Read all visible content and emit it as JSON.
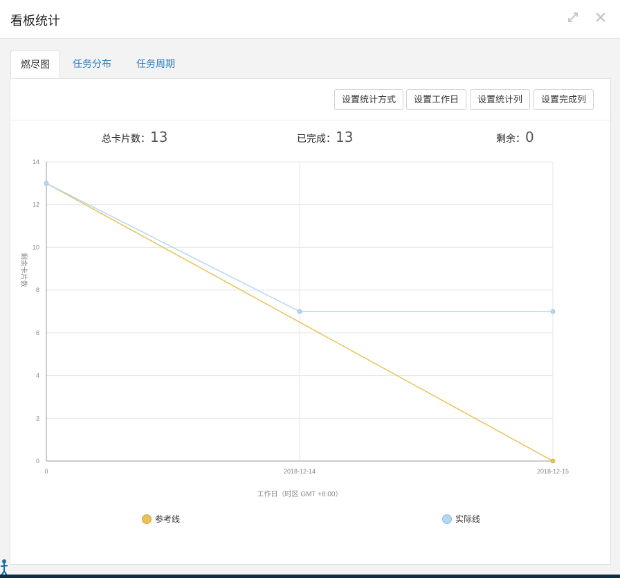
{
  "header": {
    "title": "看板统计",
    "expand_icon": "expand-icon",
    "close_icon": "close-icon"
  },
  "tabs": [
    {
      "label": "燃尽图",
      "active": true
    },
    {
      "label": "任务分布",
      "active": false
    },
    {
      "label": "任务周期",
      "active": false
    }
  ],
  "toolbar": {
    "btn_method": "设置统计方式",
    "btn_workday": "设置工作日",
    "btn_column": "设置统计列",
    "btn_done": "设置完成列"
  },
  "stats": {
    "total_label": "总卡片数：",
    "total_value": "13",
    "done_label": "已完成：",
    "done_value": "13",
    "remain_label": "剩余：",
    "remain_value": "0"
  },
  "colors": {
    "reference": "#e8c25a",
    "actual": "#b3d7f2",
    "link": "#2a7fbf"
  },
  "chart_data": {
    "type": "line",
    "categories": [
      "0",
      "2018-12-14",
      "2018-12-15"
    ],
    "ylabel": "剩余卡片数",
    "xlabel": "工作日（时区 GMT +8:00）",
    "ylim": [
      0,
      14
    ],
    "yticks": [
      0,
      2,
      4,
      6,
      8,
      10,
      12,
      14
    ],
    "grid": true,
    "legend_position": "bottom",
    "series": [
      {
        "name": "参考线",
        "color": "#e8c25a",
        "values": [
          13,
          6.5,
          0
        ]
      },
      {
        "name": "实际线",
        "color": "#b3d7f2",
        "values": [
          13,
          7,
          7
        ]
      }
    ]
  }
}
